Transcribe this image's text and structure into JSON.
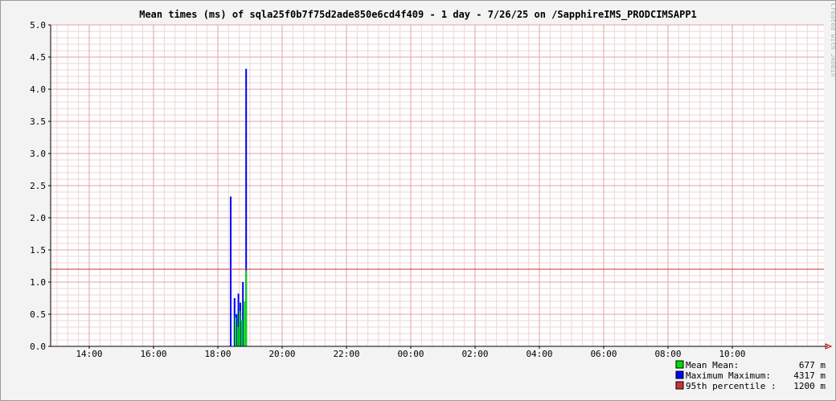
{
  "chart_data": {
    "type": "bar",
    "title": "Mean times (ms) of sqla25f0b7f75d2ade850e6cd4f409 - 1 day - 7/26/25 on /SapphireIMS_PRODCIMSAPP1",
    "watermark": "Created with JRobin",
    "ylim": [
      0,
      5
    ],
    "y_ticks": [
      "0.0",
      "0.5",
      "1.0",
      "1.5",
      "2.0",
      "2.5",
      "3.0",
      "3.5",
      "4.0",
      "4.5",
      "5.0"
    ],
    "x_range_hours": [
      12.75,
      12.85
    ],
    "x_ticks": [
      {
        "label": "14:00",
        "hour": 14
      },
      {
        "label": "16:00",
        "hour": 16
      },
      {
        "label": "18:00",
        "hour": 18
      },
      {
        "label": "20:00",
        "hour": 20
      },
      {
        "label": "22:00",
        "hour": 22
      },
      {
        "label": "00:00",
        "hour": 24
      },
      {
        "label": "02:00",
        "hour": 26
      },
      {
        "label": "04:00",
        "hour": 28
      },
      {
        "label": "06:00",
        "hour": 30
      },
      {
        "label": "08:00",
        "hour": 32
      },
      {
        "label": "10:00",
        "hour": 34
      }
    ],
    "percentile_line": 1.2,
    "series": [
      {
        "name": "Mean",
        "color": "#00dd00",
        "points": [
          {
            "hour": 18.4,
            "value": 0.0
          },
          {
            "hour": 18.55,
            "value": 0.45
          },
          {
            "hour": 18.62,
            "value": 0.3
          },
          {
            "hour": 18.68,
            "value": 0.55
          },
          {
            "hour": 18.75,
            "value": 0.4
          },
          {
            "hour": 18.82,
            "value": 0.7
          },
          {
            "hour": 18.88,
            "value": 1.18
          }
        ]
      },
      {
        "name": "Maximum",
        "color": "#0000ff",
        "points": [
          {
            "hour": 18.4,
            "value": 2.33
          },
          {
            "hour": 18.52,
            "value": 0.75
          },
          {
            "hour": 18.58,
            "value": 0.5
          },
          {
            "hour": 18.64,
            "value": 0.82
          },
          {
            "hour": 18.7,
            "value": 0.68
          },
          {
            "hour": 18.78,
            "value": 1.0
          },
          {
            "hour": 18.88,
            "value": 4.317
          }
        ]
      }
    ],
    "legend": [
      {
        "label": "Mean  Mean:",
        "value": "677 m",
        "color": "#00dd00"
      },
      {
        "label": "Maximum  Maximum:",
        "value": "4317 m",
        "color": "#0000ff"
      },
      {
        "label": "95th percentile  :",
        "value": "1200 m",
        "color": "#cc3333"
      }
    ],
    "grid": true,
    "legend_position": "bottom-right",
    "colors": {
      "background": "#f3f3f3",
      "plot_background": "#ffffff",
      "grid_minor": "#ecd6d6",
      "grid_major": "#e0a3a3",
      "axis": "#000000",
      "percentile": "#cc3333",
      "arrow": "#cc0000"
    }
  }
}
